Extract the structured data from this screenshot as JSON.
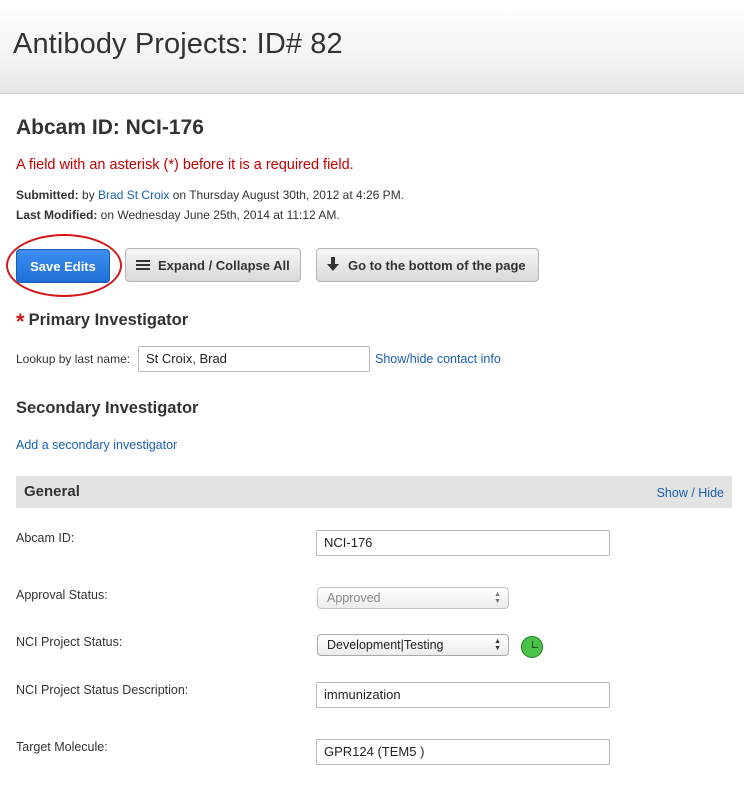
{
  "header": {
    "title": "Antibody Projects: ID# 82"
  },
  "record": {
    "title": "Abcam ID: NCI-176",
    "required_note": "A field with an asterisk (*) before it is a required field.",
    "submitted_label": "Submitted:",
    "submitted_by_prefix": "by",
    "submitted_by_name": "Brad St Croix",
    "submitted_on": "on Thursday August 30th, 2012 at 4:26 PM.",
    "modified_label": "Last Modified:",
    "modified_on": "on Wednesday June 25th, 2014 at 11:12 AM."
  },
  "toolbar": {
    "save_label": "Save Edits",
    "expand_label": "Expand / Collapse All",
    "bottom_label": "Go to the bottom of the page",
    "expand_icon": "list-icon",
    "bottom_icon": "arrow-down-icon"
  },
  "primary_investigator": {
    "required_mark": "*",
    "heading": "Primary Investigator",
    "lookup_label": "Lookup by last name:",
    "lookup_value": "St Croix, Brad",
    "contact_link": "Show/hide contact info"
  },
  "secondary_investigator": {
    "heading": "Secondary Investigator",
    "add_link": "Add a secondary investigator"
  },
  "general": {
    "heading": "General",
    "toggle_label": "Show / Hide",
    "abcam_id_label": "Abcam ID:",
    "abcam_id_value": "NCI-176",
    "approval_status_label": "Approval Status:",
    "approval_status_value": "Approved",
    "nci_status_label": "NCI Project Status:",
    "nci_status_value": "Development|Testing",
    "nci_status_icon": "clock-icon",
    "nci_desc_label": "NCI Project Status Description:",
    "nci_desc_value": "immunization",
    "target_label": "Target Molecule:",
    "target_value": "GPR124 (TEM5 )"
  },
  "colors": {
    "accent_blue": "#1f6fd8",
    "required_red": "#c00000",
    "link_blue": "#1a5fb4",
    "status_green": "#49c249"
  }
}
